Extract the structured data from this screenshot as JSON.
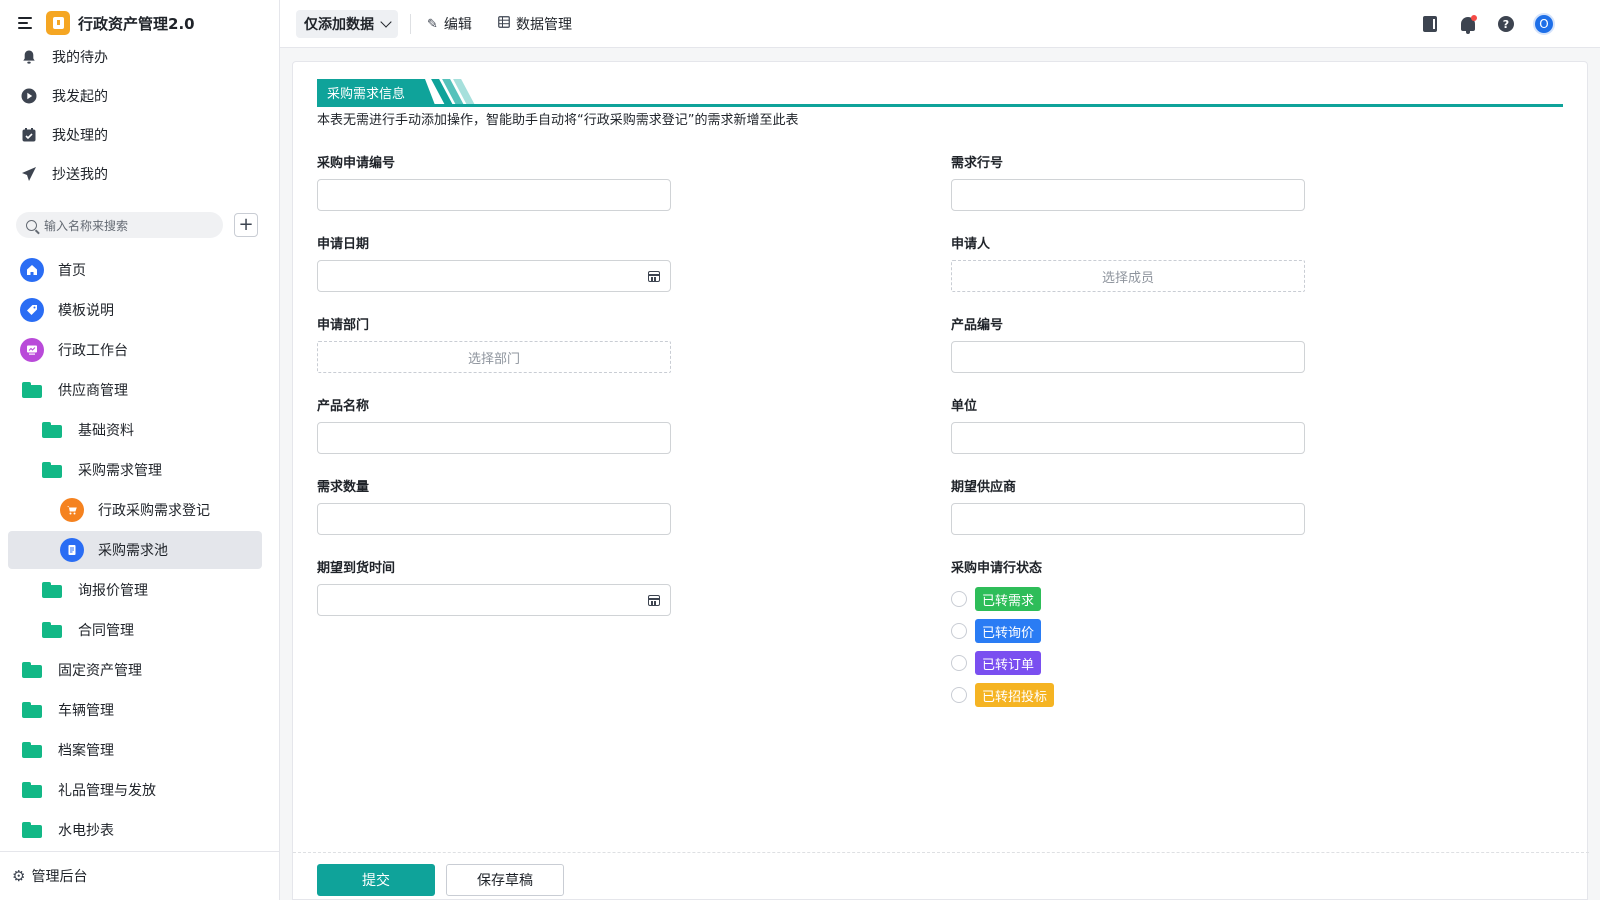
{
  "sidebar": {
    "app_title": "行政资产管理2.0",
    "quick": [
      {
        "label": "我的待办",
        "icon": "bell-icon"
      },
      {
        "label": "我发起的",
        "icon": "play-circle-icon"
      },
      {
        "label": "我处理的",
        "icon": "check-box-icon"
      },
      {
        "label": "抄送我的",
        "icon": "send-icon"
      }
    ],
    "search_placeholder": "输入名称来搜索",
    "nav": [
      {
        "label": "首页",
        "icon": "home-icon",
        "color": "#2a6df4"
      },
      {
        "label": "模板说明",
        "icon": "tag-icon",
        "color": "#2a6df4"
      },
      {
        "label": "行政工作台",
        "icon": "dashboard-icon",
        "color": "#b94ad9"
      },
      {
        "label": "供应商管理",
        "icon": "folder-open-icon"
      },
      {
        "label": "基础资料",
        "icon": "folder-icon"
      },
      {
        "label": "采购需求管理",
        "icon": "folder-open-icon"
      },
      {
        "label": "行政采购需求登记",
        "icon": "cart-icon",
        "color": "#f5821f"
      },
      {
        "label": "采购需求池",
        "icon": "document-icon",
        "color": "#2a6df4"
      },
      {
        "label": "询报价管理",
        "icon": "folder-icon"
      },
      {
        "label": "合同管理",
        "icon": "folder-icon"
      },
      {
        "label": "固定资产管理",
        "icon": "folder-icon"
      },
      {
        "label": "车辆管理",
        "icon": "folder-icon"
      },
      {
        "label": "档案管理",
        "icon": "folder-icon"
      },
      {
        "label": "礼品管理与发放",
        "icon": "folder-icon"
      },
      {
        "label": "水电抄表",
        "icon": "folder-icon"
      }
    ],
    "footer_label": "管理后台"
  },
  "topbar": {
    "view_label": "仅添加数据",
    "edit_label": "编辑",
    "data_mgmt_label": "数据管理",
    "avatar_letter": "O"
  },
  "form": {
    "section_title": "采购需求信息",
    "description": "本表无需进行手动添加操作，智能助手自动将“行政采购需求登记”的需求新增至此表",
    "fields": {
      "purchase_no": "采购申请编号",
      "line_no": "需求行号",
      "apply_date": "申请日期",
      "applicant": "申请人",
      "applicant_placeholder": "选择成员",
      "department": "申请部门",
      "department_placeholder": "选择部门",
      "product_code": "产品编号",
      "product_name": "产品名称",
      "unit": "单位",
      "quantity": "需求数量",
      "supplier": "期望供应商",
      "arrival": "期望到货时间",
      "status": "采购申请行状态"
    },
    "status_options": [
      {
        "label": "已转需求",
        "color": "#2ebd59"
      },
      {
        "label": "已转询价",
        "color": "#2a7cf4"
      },
      {
        "label": "已转订单",
        "color": "#7a4ff0"
      },
      {
        "label": "已转招投标",
        "color": "#f5b423"
      }
    ],
    "submit_label": "提交",
    "draft_label": "保存草稿"
  },
  "colors": {
    "accent": "#0fa39a"
  }
}
